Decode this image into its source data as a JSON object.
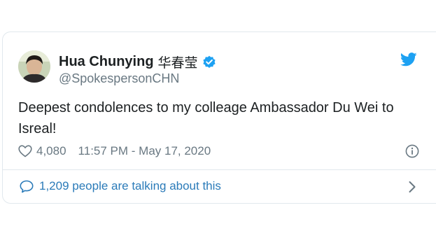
{
  "tweet": {
    "author_name": "Hua Chunying",
    "author_name_cjk": "华春莹",
    "handle": "@SpokespersonCHN",
    "text": "Deepest condolences to my colleage Ambassador Du Wei to Isreal!",
    "likes": "4,080",
    "timestamp": "11:57 PM - May 17, 2020",
    "conversation": "1,209 people are talking about this"
  },
  "icons": {
    "verified": "verified-badge-icon",
    "logo": "twitter-bird-icon",
    "like": "heart-icon",
    "info": "info-icon",
    "reply": "speech-bubble-icon",
    "chevron": "chevron-right-icon"
  },
  "colors": {
    "brand": "#1da1f2",
    "link": "#2b7bb9",
    "muted": "#697882",
    "border": "#e1e8ed"
  }
}
